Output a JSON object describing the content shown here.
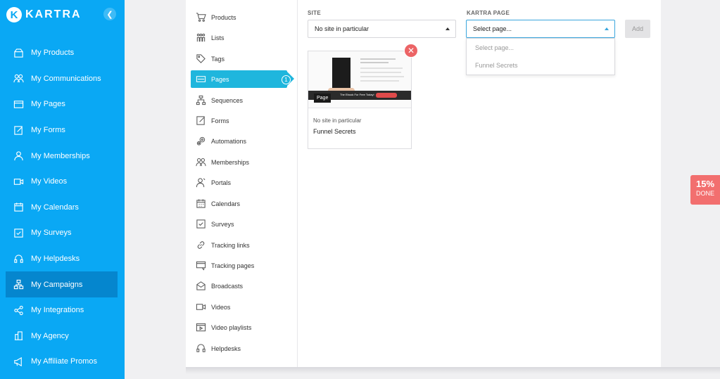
{
  "brand": {
    "name": "KARTRA",
    "logo_letter": "K"
  },
  "sidebar": {
    "items": [
      {
        "label": "My Products",
        "icon": "products-icon"
      },
      {
        "label": "My Communications",
        "icon": "communications-icon"
      },
      {
        "label": "My Pages",
        "icon": "pages-icon"
      },
      {
        "label": "My Forms",
        "icon": "forms-icon"
      },
      {
        "label": "My Memberships",
        "icon": "memberships-icon"
      },
      {
        "label": "My Videos",
        "icon": "videos-icon"
      },
      {
        "label": "My Calendars",
        "icon": "calendars-icon"
      },
      {
        "label": "My Surveys",
        "icon": "surveys-icon"
      },
      {
        "label": "My Helpdesks",
        "icon": "helpdesks-icon"
      },
      {
        "label": "My Campaigns",
        "icon": "campaigns-icon",
        "active": true
      },
      {
        "label": "My Integrations",
        "icon": "integrations-icon"
      },
      {
        "label": "My Agency",
        "icon": "agency-icon"
      },
      {
        "label": "My Affiliate Promos",
        "icon": "megaphone-icon"
      }
    ]
  },
  "subnav": {
    "items": [
      {
        "label": "Products",
        "icon": "cart-icon"
      },
      {
        "label": "Lists",
        "icon": "lists-icon"
      },
      {
        "label": "Tags",
        "icon": "tag-icon"
      },
      {
        "label": "Pages",
        "icon": "pages-icon",
        "active": true
      },
      {
        "label": "Sequences",
        "icon": "sequences-icon"
      },
      {
        "label": "Forms",
        "icon": "forms-icon"
      },
      {
        "label": "Automations",
        "icon": "gears-icon"
      },
      {
        "label": "Memberships",
        "icon": "memberships-icon"
      },
      {
        "label": "Portals",
        "icon": "portals-icon"
      },
      {
        "label": "Calendars",
        "icon": "calendar-icon"
      },
      {
        "label": "Surveys",
        "icon": "checkbox-icon"
      },
      {
        "label": "Tracking links",
        "icon": "link-icon"
      },
      {
        "label": "Tracking pages",
        "icon": "tracking-pages-icon"
      },
      {
        "label": "Broadcasts",
        "icon": "envelope-icon"
      },
      {
        "label": "Videos",
        "icon": "video-icon"
      },
      {
        "label": "Video playlists",
        "icon": "playlist-icon"
      },
      {
        "label": "Helpdesks",
        "icon": "headset-icon"
      }
    ],
    "pages_count": "1"
  },
  "form": {
    "site_label": "SITE",
    "site_value": "No site in particular",
    "page_label": "KARTRA PAGE",
    "page_value": "Select page...",
    "add_label": "Add"
  },
  "dropdown": {
    "options": [
      "Select page...",
      "Funnel Secrets"
    ]
  },
  "card": {
    "tag": "Page",
    "site": "No site in particular",
    "name": "Funnel Secrets",
    "thumb_bar_text": "The Ebook For Free Today!"
  },
  "progress": {
    "percent": "15%",
    "label": "DONE"
  },
  "colors": {
    "sidebar": "#0aa8f4",
    "active_subnav": "#1fb6dd",
    "remove": "#ec6466",
    "progress": "#f26f6f"
  }
}
